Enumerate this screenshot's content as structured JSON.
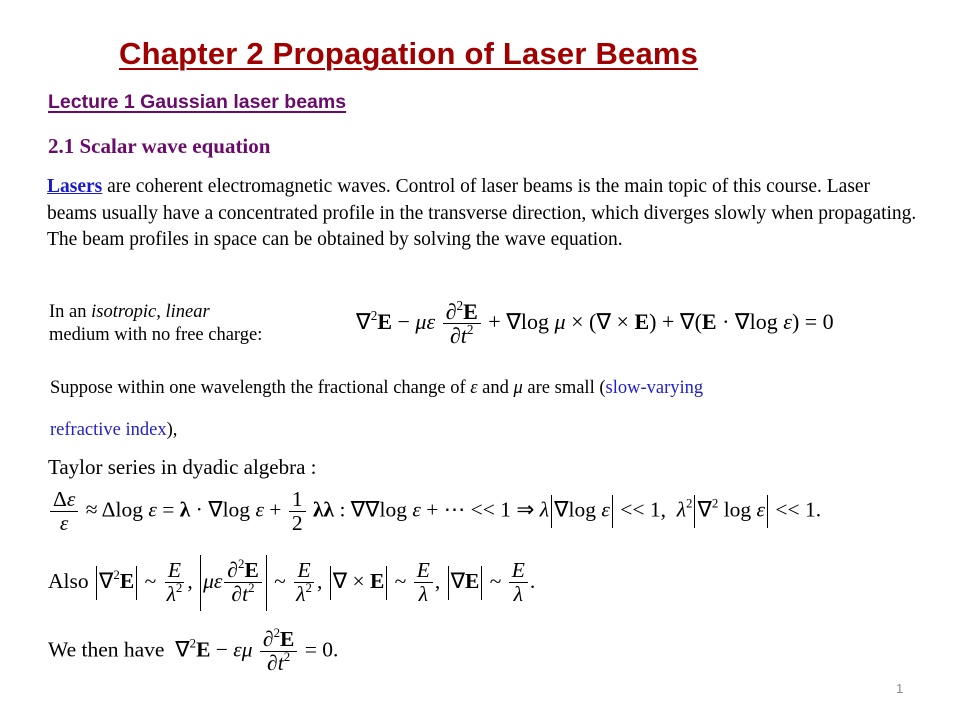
{
  "slide": {
    "title": "Chapter 2 Propagation of Laser Beams",
    "lecture": "Lecture 1 Gaussian laser beams",
    "section": "2.1 Scalar wave equation",
    "intro": {
      "link_text": "Lasers",
      "text": " are coherent electromagnetic waves. Control of laser beams is the main topic of this course. Laser beams usually have a concentrated profile in the transverse direction, which diverges slowly when propagating. The beam profiles in space can be obtained by solving the wave equation."
    },
    "medium": {
      "prefix": "In an ",
      "italic": "isotropic, linear",
      "suffix": "medium with no free charge:"
    },
    "suppose": {
      "text1": "Suppose within one wavelength the fractional change of ",
      "eps": "ε",
      "and": " and ",
      "mu": "μ",
      "text2": " are small (",
      "blue1": "slow-varying",
      "blue2": "refractive index",
      "text3": "),"
    },
    "taylor_label": "Taylor series in dyadic algebra :",
    "also_label": "Also",
    "then_label": "We then have",
    "page_number": "1",
    "colors": {
      "title": "#a00000",
      "heading": "#6a0a6a",
      "link": "#1a1acc",
      "highlight": "#2020cc"
    }
  }
}
